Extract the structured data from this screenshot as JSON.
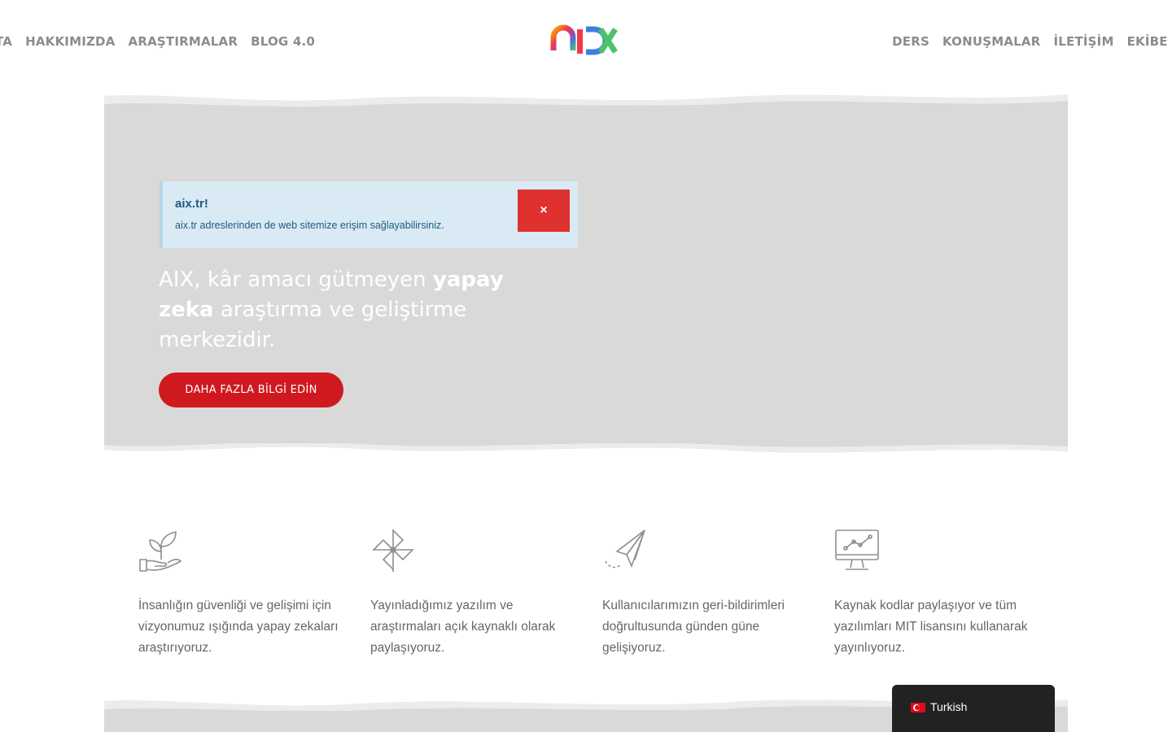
{
  "nav": {
    "left_items": [
      "TA",
      "HAKKIMIZDA",
      "ARAŞTIRMALAR",
      "BLOG 4.0"
    ],
    "right_items": [
      "DERS",
      "KONUŞMALAR",
      "İLETİŞİM",
      "EKİBE K"
    ],
    "logo_icon": "aix-logo-icon"
  },
  "alert": {
    "title": "aix.tr!",
    "text": "aix.tr adreslerinden de web sitemize erişim sağlayabilirsiniz.",
    "close_label": "×"
  },
  "hero": {
    "headline_part1": "AIX, kâr amacı gütmeyen ",
    "headline_bold1": "yapay zeka",
    "headline_part2": " araştırma ve geliştirme merkezidir.",
    "cta_label": "DAHA FAZLA BİLGİ EDİN"
  },
  "features": [
    {
      "icon": "plant-hand-icon",
      "text": "İnsanlığın güvenliği ve gelişimi için vizyonumuz ışığında yapay zekaları araştırıyoruz."
    },
    {
      "icon": "pinwheel-icon",
      "text": "Yayınladığımız yazılım ve araştırmaları açık kaynaklı olarak paylaşıyoruz."
    },
    {
      "icon": "paper-plane-icon",
      "text": "Kullanıcılarımızın geri-bildirimleri doğrultusunda günden güne gelişiyoruz."
    },
    {
      "icon": "monitor-chart-icon",
      "text": "Kaynak kodlar paylaşıyor ve tüm yazılımları MIT lisansını kullanarak yayınlıyoruz."
    }
  ],
  "language": {
    "label": "Turkish",
    "flag_icon": "turkey-flag-icon"
  },
  "colors": {
    "accent": "#d0181f",
    "hero_bg": "#d9d9d9",
    "alert_bg": "#d9eaf4",
    "alert_text": "#1e5a80"
  }
}
